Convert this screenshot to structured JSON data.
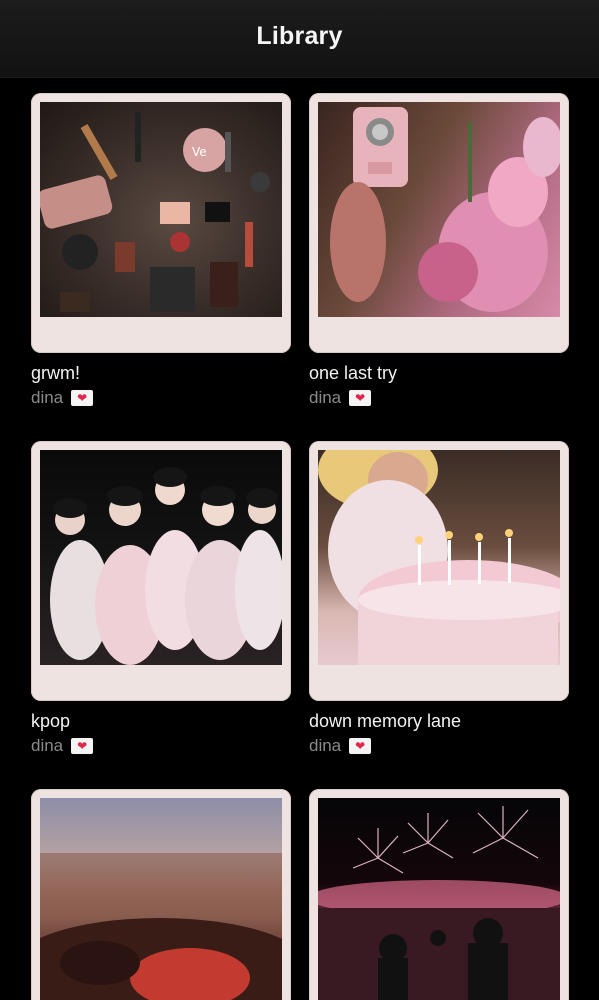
{
  "header": {
    "title": "Library"
  },
  "playlists": [
    {
      "title": "grwm!",
      "author": "dina",
      "badge_icon": "heart-icon"
    },
    {
      "title": "one last try",
      "author": "dina",
      "badge_icon": "heart-icon"
    },
    {
      "title": "kpop",
      "author": "dina",
      "badge_icon": "heart-icon"
    },
    {
      "title": "down memory lane",
      "author": "dina",
      "badge_icon": "heart-icon"
    },
    {
      "title": "",
      "author": "",
      "badge_icon": ""
    },
    {
      "title": "",
      "author": "",
      "badge_icon": ""
    }
  ],
  "colors": {
    "background": "#000000",
    "polaroid_frame": "#efe3e1",
    "title_text": "#f2f2f2",
    "author_text": "#8a8a8a",
    "heart": "#e0264a"
  }
}
